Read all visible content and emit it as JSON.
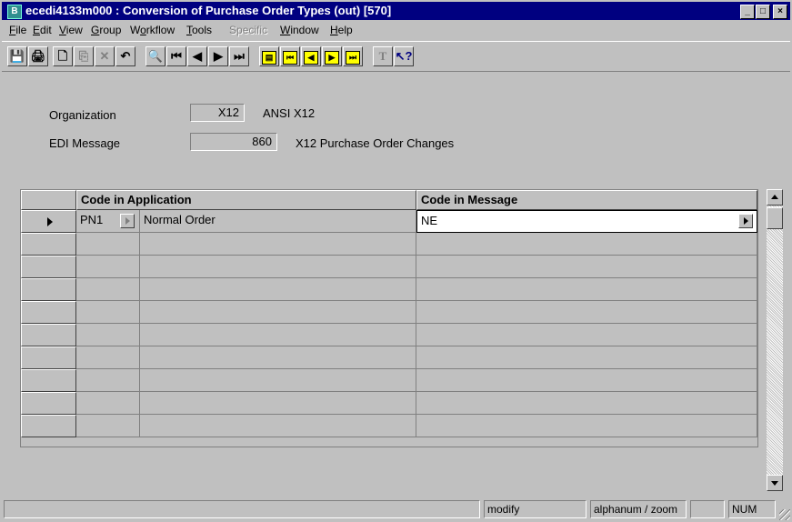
{
  "window": {
    "title": "ecedi4133m000 : Conversion of Purchase Order Types (out) [570]",
    "app_icon": "B",
    "controls": {
      "minimize": "_",
      "maximize": "□",
      "close": "×"
    }
  },
  "menu": [
    {
      "pre": "",
      "key": "F",
      "post": "ile",
      "enabled": true
    },
    {
      "pre": "",
      "key": "E",
      "post": "dit",
      "enabled": true
    },
    {
      "pre": "",
      "key": "V",
      "post": "iew",
      "enabled": true
    },
    {
      "pre": "",
      "key": "G",
      "post": "roup",
      "enabled": true
    },
    {
      "pre": "W",
      "key": "o",
      "post": "rkflow",
      "enabled": true
    },
    {
      "pre": "",
      "key": "T",
      "post": "ools",
      "enabled": true
    },
    {
      "pre": "",
      "key": "S",
      "post": "pecific",
      "enabled": false
    },
    {
      "pre": "",
      "key": "W",
      "post": "indow",
      "enabled": true
    },
    {
      "pre": "",
      "key": "H",
      "post": "elp",
      "enabled": true
    }
  ],
  "toolbar": {
    "save": "💾",
    "print": "🖨",
    "new": "🗋",
    "copy": "⎘",
    "delete": "✕",
    "undo": "↶",
    "find": "🔍",
    "first": "⏮",
    "prev": "◀",
    "next": "▶",
    "last": "⏭",
    "y1": "▤",
    "y2": "⏮",
    "y3": "◀",
    "y4": "▶",
    "y5": "⏭",
    "text": "T",
    "help": "↖?"
  },
  "form": {
    "organization_label": "Organization",
    "organization_value": "X12",
    "organization_desc": "ANSI X12",
    "edi_message_label": "EDI Message",
    "edi_message_value": "860",
    "edi_message_desc": "X12 Purchase Order Changes"
  },
  "grid": {
    "headers": [
      "Code in Application",
      "Code in Message"
    ],
    "rows": [
      {
        "code": "PN1",
        "desc": "Normal Order",
        "message_code": "NE"
      }
    ]
  },
  "status": {
    "mode": "modify",
    "input": "alphanum / zoom",
    "blank": "",
    "num": "NUM"
  },
  "colors": {
    "title_bg": "#000080",
    "face": "#c0c0c0",
    "highlight_yellow": "#ffff00"
  }
}
